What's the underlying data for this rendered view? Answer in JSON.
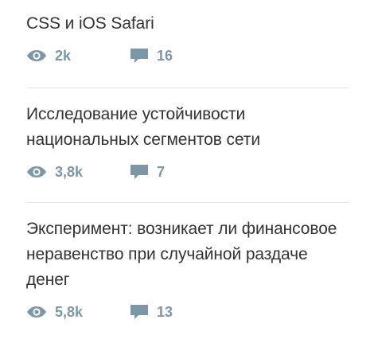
{
  "colors": {
    "title": "#333333",
    "meta": "#7b98a8",
    "divider": "#e3e6e8"
  },
  "posts": [
    {
      "title": "CSS и iOS Safari",
      "views": "2k",
      "comments": "16",
      "view_icon": "eye-icon",
      "comment_icon": "comment-icon"
    },
    {
      "title": "Исследование устойчивости национальных сегментов сети",
      "views": "3,8k",
      "comments": "7",
      "view_icon": "eye-icon",
      "comment_icon": "comment-icon"
    },
    {
      "title": "Эксперимент: возникает ли финансовое неравенство при случайной раздаче денег",
      "views": "5,8k",
      "comments": "13",
      "view_icon": "eye-icon",
      "comment_icon": "comment-icon"
    }
  ]
}
